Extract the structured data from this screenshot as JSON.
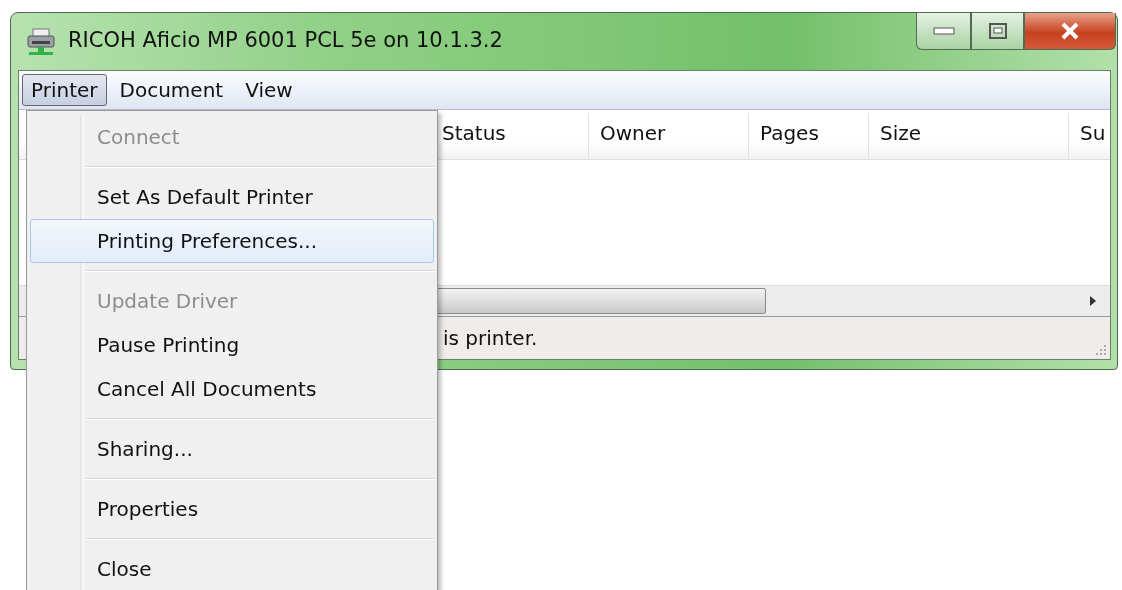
{
  "window": {
    "title": "RICOH Aficio MP 6001 PCL 5e on 10.1.3.2"
  },
  "menu_bar": [
    {
      "label": "Printer",
      "selected": true
    },
    {
      "label": "Document",
      "selected": false
    },
    {
      "label": "View",
      "selected": false
    }
  ],
  "table": {
    "columns": [
      "Status",
      "Owner",
      "Pages",
      "Size",
      "Su"
    ]
  },
  "status_bar": {
    "text": "is printer."
  },
  "menu": {
    "items": [
      {
        "kind": "item",
        "label": "Connect",
        "disabled": true,
        "selected": false
      },
      {
        "kind": "separator"
      },
      {
        "kind": "item",
        "label": "Set As Default Printer",
        "disabled": false,
        "selected": false
      },
      {
        "kind": "item",
        "label": "Printing Preferences...",
        "disabled": false,
        "selected": true
      },
      {
        "kind": "separator"
      },
      {
        "kind": "item",
        "label": "Update Driver",
        "disabled": true,
        "selected": false
      },
      {
        "kind": "item",
        "label": "Pause Printing",
        "disabled": false,
        "selected": false
      },
      {
        "kind": "item",
        "label": "Cancel All Documents",
        "disabled": false,
        "selected": false
      },
      {
        "kind": "separator"
      },
      {
        "kind": "item",
        "label": "Sharing...",
        "disabled": false,
        "selected": false
      },
      {
        "kind": "separator"
      },
      {
        "kind": "item",
        "label": "Properties",
        "disabled": false,
        "selected": false
      },
      {
        "kind": "separator"
      },
      {
        "kind": "item",
        "label": "Close",
        "disabled": false,
        "selected": false
      }
    ]
  }
}
